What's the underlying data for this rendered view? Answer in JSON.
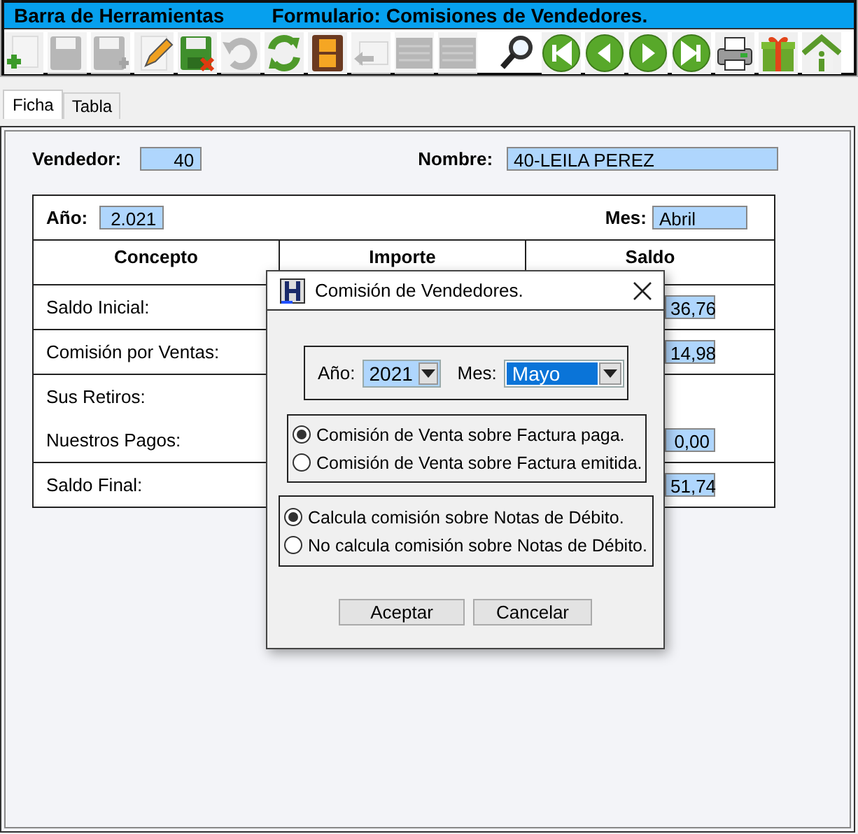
{
  "toolbar": {
    "title": "Barra de Herramientas",
    "form_title": "Formulario: Comisiones de Vendedores.",
    "buttons": [
      {
        "kind": "add",
        "disabled": false
      },
      {
        "kind": "save",
        "disabled": true
      },
      {
        "kind": "saveas",
        "disabled": true
      },
      {
        "kind": "edit",
        "disabled": false
      },
      {
        "kind": "savecancel",
        "disabled": false
      },
      {
        "kind": "undo",
        "disabled": true
      },
      {
        "kind": "refresh",
        "disabled": false
      },
      {
        "kind": "film",
        "disabled": false
      },
      {
        "kind": "reply",
        "disabled": true
      },
      {
        "kind": "list",
        "disabled": true
      },
      {
        "kind": "list",
        "disabled": true
      },
      {
        "kind": "search",
        "disabled": false
      },
      {
        "kind": "first",
        "disabled": false
      },
      {
        "kind": "prev",
        "disabled": false
      },
      {
        "kind": "next",
        "disabled": false
      },
      {
        "kind": "last",
        "disabled": false
      },
      {
        "kind": "printer",
        "disabled": false
      },
      {
        "kind": "gift",
        "disabled": false
      },
      {
        "kind": "home",
        "disabled": false
      }
    ]
  },
  "tabs": [
    {
      "label": "Ficha",
      "selected": true
    },
    {
      "label": "Tabla",
      "selected": false
    }
  ],
  "form": {
    "vendedor_label": "Vendedor:",
    "vendedor": "40",
    "nombre_label": "Nombre:",
    "nombre": "40-LEILA PEREZ",
    "anio_label": "Año:",
    "anio": "2.021",
    "mes_label": "Mes:",
    "mes": "Abril",
    "table": {
      "columns": [
        "Concepto",
        "Importe",
        "Saldo"
      ],
      "rows": [
        {
          "labels": [
            "Saldo Inicial:"
          ],
          "saldo": "36,76"
        },
        {
          "labels": [
            "Comisión por Ventas:"
          ],
          "saldo": "14,98"
        },
        {
          "labels": [
            "Sus Retiros:",
            "Nuestros Pagos:"
          ],
          "saldo": "0,00"
        },
        {
          "labels": [
            "Saldo Final:"
          ],
          "saldo": "51,74"
        }
      ]
    }
  },
  "dialog": {
    "title": "Comisión de Vendedores.",
    "anio_label": "Año:",
    "anio": "2021",
    "mes_label": "Mes:",
    "mes": "Mayo",
    "groups": [
      {
        "options": [
          {
            "label": "Comisión de Venta sobre Factura paga.",
            "selected": true
          },
          {
            "label": "Comisión de Venta sobre Factura emitida.",
            "selected": false
          }
        ]
      },
      {
        "options": [
          {
            "label": "Calcula comisión sobre Notas de Débito.",
            "selected": true
          },
          {
            "label": "No calcula comisión sobre Notas de Débito.",
            "selected": false
          }
        ]
      }
    ],
    "buttons": [
      "Aceptar",
      "Cancelar"
    ]
  }
}
